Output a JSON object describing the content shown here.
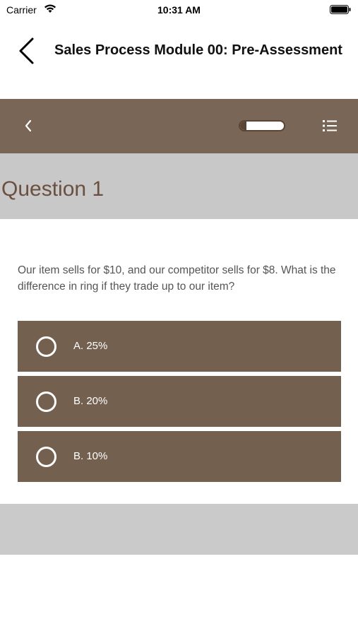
{
  "status_bar": {
    "carrier": "Carrier",
    "time": "10:31 AM",
    "icons": [
      "wifi-icon",
      "battery-icon"
    ]
  },
  "nav": {
    "title": "Sales Process Module 00: Pre-Assessment",
    "back_icon": "chevron-left-icon"
  },
  "toolbar": {
    "back_icon": "chevron-left-icon",
    "progress_fraction": 0.15,
    "menu_icon": "list-icon",
    "color": "#7a6656"
  },
  "question": {
    "title": "Question 1",
    "text": "Our item sells for $10, and our competitor sells for $8. What is the difference in ring if they trade up to our item?"
  },
  "options": [
    {
      "label": "A. 25%",
      "selected": false
    },
    {
      "label": "B. 20%",
      "selected": false
    },
    {
      "label": "B. 10%",
      "selected": false
    }
  ],
  "colors": {
    "brand": "#73604f",
    "header_gray": "#c8c8c8",
    "title_brown": "#6b5040"
  }
}
